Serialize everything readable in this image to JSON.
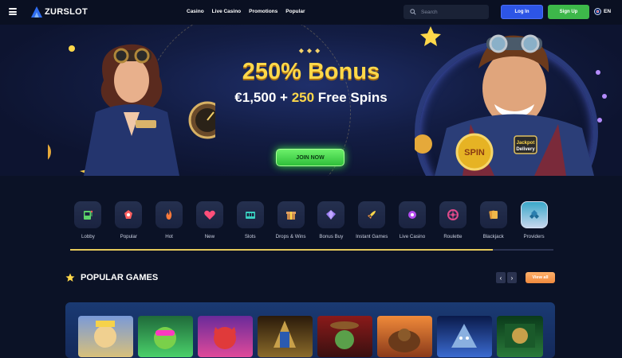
{
  "header": {
    "logo_text": "ZURSLOT",
    "nav": [
      "Casino",
      "Live Casino",
      "Promotions",
      "Popular"
    ],
    "search_placeholder": "Search",
    "login_label": "Log In",
    "signup_label": "Sign Up",
    "language": "EN"
  },
  "banner": {
    "headline": "250% Bonus",
    "amount": "€1,500",
    "plus": "+",
    "spins_count": "250",
    "spins_text": "Free Spins",
    "cta_label": "JOIN NOW",
    "slide_count": 3,
    "active_slide": 1
  },
  "categories": [
    {
      "label": "Lobby",
      "icon": "slot-machine-icon"
    },
    {
      "label": "Popular",
      "icon": "popular-icon"
    },
    {
      "label": "Hot",
      "icon": "fire-icon"
    },
    {
      "label": "New",
      "icon": "heart-icon"
    },
    {
      "label": "Slots",
      "icon": "slots-icon"
    },
    {
      "label": "Drops & Wins",
      "icon": "gift-icon"
    },
    {
      "label": "Bonus Buy",
      "icon": "bonus-buy-icon"
    },
    {
      "label": "Instant Games",
      "icon": "rocket-icon"
    },
    {
      "label": "Live Casino",
      "icon": "live-casino-icon"
    },
    {
      "label": "Roulette",
      "icon": "roulette-icon"
    },
    {
      "label": "Blackjack",
      "icon": "cards-icon"
    },
    {
      "label": "Providers",
      "icon": "providers-icon",
      "active": true
    }
  ],
  "popular": {
    "title": "POPULAR GAMES",
    "prev": "‹",
    "next": "›",
    "view_all_label": "View all"
  },
  "colors": {
    "accent_gold": "#ffd84a",
    "login_blue": "#2d55e6",
    "signup_green": "#3db84a",
    "cta_green": "#2fbf3a"
  }
}
